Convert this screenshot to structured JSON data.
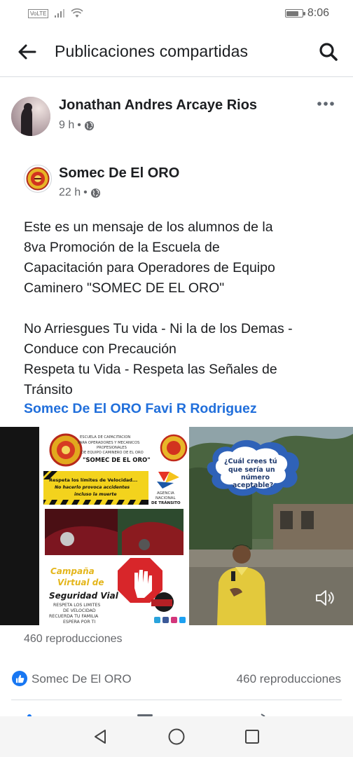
{
  "status_bar": {
    "network_badge": "VoLTE",
    "time": "8:06",
    "battery_level": 0.8
  },
  "header": {
    "title": "Publicaciones compartidas"
  },
  "post": {
    "author": "Jonathan Andres Arcaye Rios",
    "time": "9 h",
    "privacy_icon": "globe-icon"
  },
  "shared_post": {
    "page_name": "Somec De El ORO",
    "time": "22 h",
    "privacy_icon": "globe-icon",
    "text_lines_1": [
      "Este es un mensaje de los alumnos de la",
      "8va Promoción de la Escuela de",
      "Capacitación para Operadores de Equipo",
      "Caminero \"SOMEC DE EL ORO\""
    ],
    "text_lines_2": [
      "No Arriesgues Tu vida - Ni la de los Demas -",
      "Conduce con Precaución",
      "Respeta tu Vida - Respeta las Señales de",
      "Tránsito"
    ],
    "tags": "Somec De El ORO Favi R Rodriguez"
  },
  "video": {
    "poster": {
      "school_line1": "ESCUELA DE CAPACITACION",
      "school_line2": "PARA OPERADORES Y MECANICOS",
      "school_line3": "PROFESIONALES",
      "school_line4": "DE EQUIPO CAMINERO DE EL ORO",
      "school_name": "\"SOMEC DE EL ORO\"",
      "warning_1": "Respeta los límites de Velocidad...",
      "warning_2": "No hacerlo provoca accidentes",
      "warning_3": "incluso la muerte",
      "agency_1": "AGENCIA",
      "agency_2": "NACIONAL",
      "agency_3": "DE TRÁNSITO",
      "campaign_1": "Campaña",
      "campaign_2": "Virtual de",
      "campaign_3": "Seguridad Vial",
      "footer_1": "RESPETA LOS LIMITES",
      "footer_2": "DE VELOCIDAD",
      "footer_3": "RECUERDA TU FAMILIA",
      "footer_4": "ESPERA POR TI"
    },
    "bubble_1": "¿Cuál crees tú",
    "bubble_2": "que sería un",
    "bubble_3": "número",
    "bubble_4": "aceptable?"
  },
  "views_label": "460 reproducciones",
  "reactions": {
    "name": "Somec De El ORO",
    "views": "460 reproducciones"
  }
}
